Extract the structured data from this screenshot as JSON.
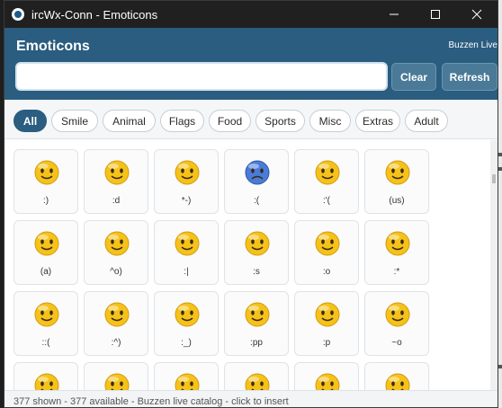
{
  "window": {
    "title": "ircWx-Conn - Emoticons",
    "controls": [
      "minimize",
      "maximize",
      "close"
    ]
  },
  "header": {
    "title": "Emoticons",
    "subtitle": "Buzzen Live",
    "search": {
      "value": "",
      "placeholder": ""
    },
    "clear_label": "Clear",
    "refresh_label": "Refresh"
  },
  "tabs": [
    {
      "label": "All",
      "active": true
    },
    {
      "label": "Smile",
      "active": false
    },
    {
      "label": "Animal",
      "active": false
    },
    {
      "label": "Flags",
      "active": false
    },
    {
      "label": "Food",
      "active": false
    },
    {
      "label": "Sports",
      "active": false
    },
    {
      "label": "Misc",
      "active": false
    },
    {
      "label": "Extras",
      "active": false
    },
    {
      "label": "Adult",
      "active": false
    }
  ],
  "emoticons": [
    {
      "code": ":)",
      "icon": "smile-face-icon"
    },
    {
      "code": ":d",
      "icon": "grin-face-icon"
    },
    {
      "code": "*-)",
      "icon": "thinking-face-icon"
    },
    {
      "code": ":(",
      "icon": "sad-blue-face-icon"
    },
    {
      "code": ":'(",
      "icon": "crying-face-icon"
    },
    {
      "code": "(us)",
      "icon": "us-face-icon"
    },
    {
      "code": "(a)",
      "icon": "angel-face-icon"
    },
    {
      "code": "^o)",
      "icon": "sarcastic-face-icon"
    },
    {
      "code": ":|",
      "icon": "neutral-face-icon"
    },
    {
      "code": ":s",
      "icon": "confused-face-icon"
    },
    {
      "code": ":o",
      "icon": "surprised-face-icon"
    },
    {
      "code": ":*",
      "icon": "secret-face-icon"
    },
    {
      "code": "::(",
      "icon": "turned-away-face-icon"
    },
    {
      "code": ":^)",
      "icon": "dont-know-face-icon"
    },
    {
      "code": ":_)",
      "icon": "cap-face-icon"
    },
    {
      "code": ":pp",
      "icon": "pouting-face-icon"
    },
    {
      "code": ":p",
      "icon": "tongue-face-icon"
    },
    {
      "code": "~o",
      "icon": "grimace-face-icon"
    },
    {
      "code": "",
      "icon": "smile-face-icon"
    },
    {
      "code": "",
      "icon": "sunglasses-face-icon"
    },
    {
      "code": "",
      "icon": "smile-face-icon"
    },
    {
      "code": "",
      "icon": "smile-face-icon"
    },
    {
      "code": "",
      "icon": "smile-face-icon"
    },
    {
      "code": "",
      "icon": "smile-face-icon"
    }
  ],
  "status": "377 shown - 377 available - Buzzen live catalog - click to insert",
  "colors": {
    "header_bg": "#2a5d7f",
    "button_bg": "#4b7a98",
    "titlebar_bg": "#202020",
    "face_yellow": "#f5c21a",
    "face_blue": "#4a7bd8"
  }
}
